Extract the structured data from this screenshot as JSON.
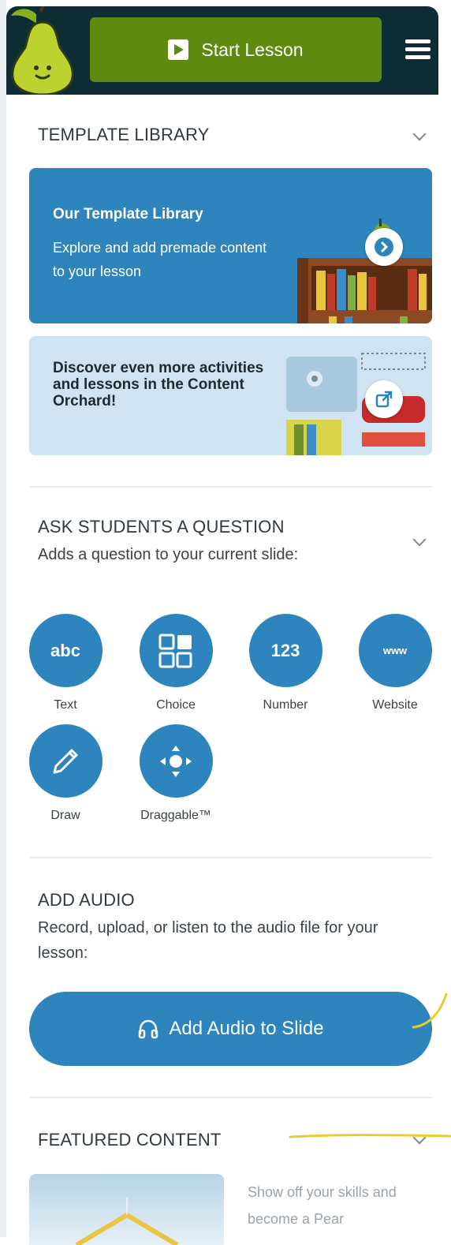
{
  "header": {
    "start_lesson_label": "Start Lesson",
    "colors": {
      "background": "#0d2c33",
      "start_button": "#5f8a10"
    }
  },
  "template_library": {
    "section_title": "TEMPLATE LIBRARY",
    "card": {
      "title": "Our Template Library",
      "description": "Explore and add premade content to your lesson"
    },
    "orchard_card": {
      "text": "Discover even more activities and lessons in the Content Orchard!"
    }
  },
  "ask_question": {
    "section_title": "ASK STUDENTS A QUESTION",
    "subtitle": "Adds a question to your current slide:",
    "types": [
      {
        "glyph": "abc",
        "label": "Text",
        "icon": "text-icon"
      },
      {
        "glyph": "",
        "label": "Choice",
        "icon": "choice-icon"
      },
      {
        "glyph": "123",
        "label": "Number",
        "icon": "number-icon"
      },
      {
        "glyph": "www",
        "label": "Website",
        "icon": "website-icon"
      },
      {
        "glyph": "",
        "label": "Draw",
        "icon": "pencil-icon"
      },
      {
        "glyph": "",
        "label": "Draggable™",
        "icon": "draggable-icon"
      }
    ]
  },
  "add_audio": {
    "section_title": "ADD AUDIO",
    "description": "Record, upload, or listen to the audio file for your lesson:",
    "button_label": "Add Audio to Slide"
  },
  "featured_content": {
    "section_title": "FEATURED CONTENT",
    "teaser": "Show off your skills and become a Pear"
  },
  "colors": {
    "accent": "#2e84bd",
    "light_card": "#cfe3f3",
    "annotation": "#e6cf2a"
  }
}
